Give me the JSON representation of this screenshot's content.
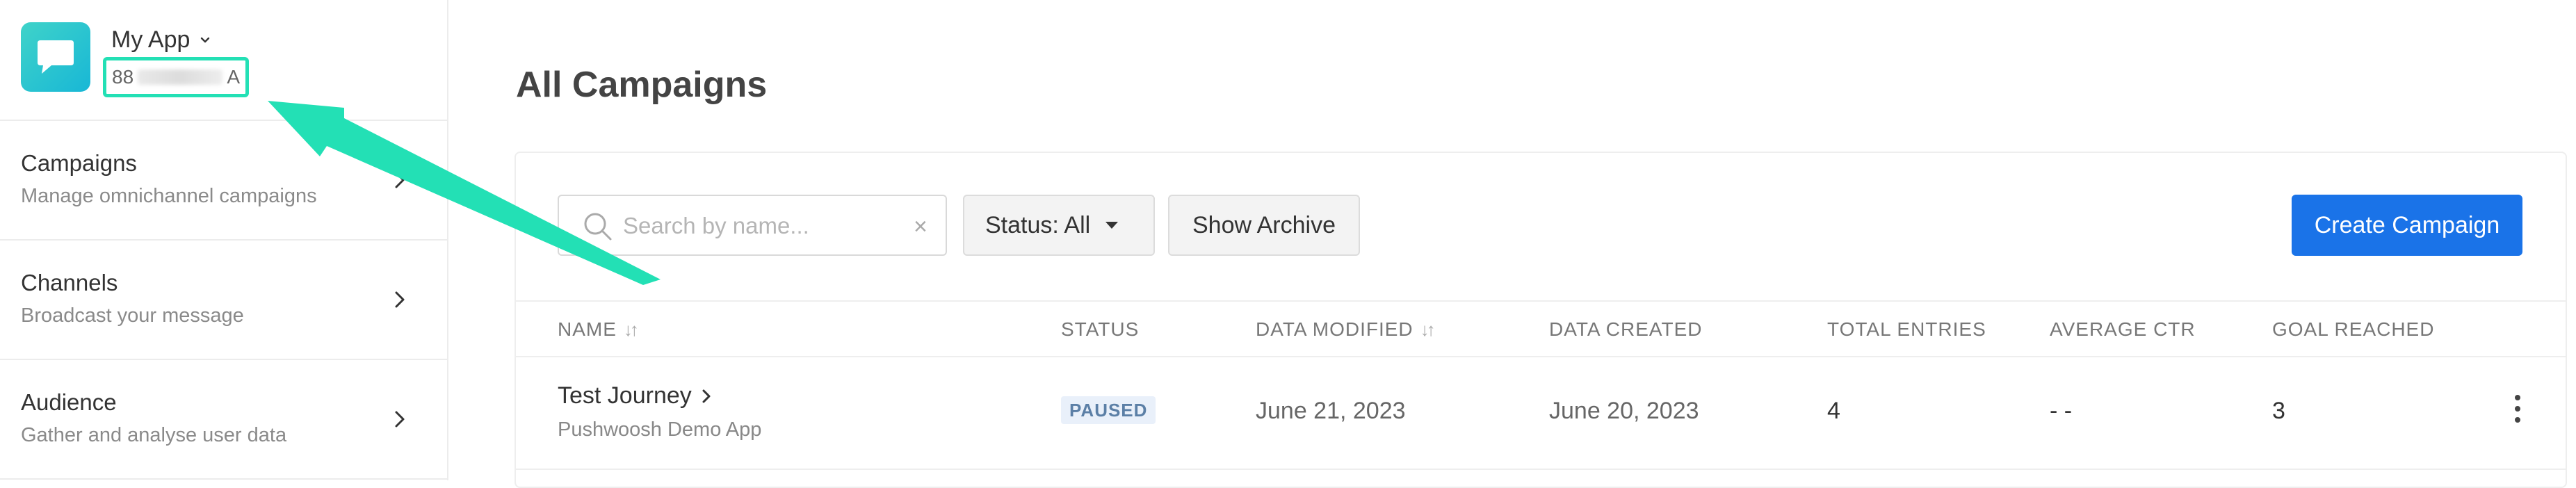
{
  "app": {
    "name": "My App",
    "id_prefix": "88",
    "id_suffix": "A"
  },
  "sidebar": {
    "items": [
      {
        "title": "Campaigns",
        "subtitle": "Manage omnichannel campaigns"
      },
      {
        "title": "Channels",
        "subtitle": "Broadcast your message"
      },
      {
        "title": "Audience",
        "subtitle": "Gather and analyse user data"
      }
    ]
  },
  "main": {
    "title": "All Campaigns",
    "search": {
      "placeholder": "Search by name...",
      "value": "",
      "clear": "×"
    },
    "status_filter": "Status: All",
    "show_archive": "Show Archive",
    "create_button": "Create Campaign",
    "columns": [
      "Name",
      "Status",
      "Data Modified",
      "Data Created",
      "Total Entries",
      "Average CTR",
      "Goal Reached"
    ],
    "rows": [
      {
        "name": "Test Journey",
        "app": "Pushwoosh Demo App",
        "status": "PAUSED",
        "modified": "June 21, 2023",
        "created": "June 20, 2023",
        "entries": "4",
        "ctr": "- -",
        "goal": "3"
      }
    ]
  },
  "colors": {
    "accent": "#1a73e8",
    "annotation": "#23e0b5",
    "logo": "#2cc8d2"
  },
  "icons": [
    "chat-bubble-icon",
    "chevron-down-icon",
    "chevron-right-icon",
    "search-icon",
    "close-icon",
    "caret-down-icon",
    "sort-icon",
    "more-vertical-icon"
  ]
}
